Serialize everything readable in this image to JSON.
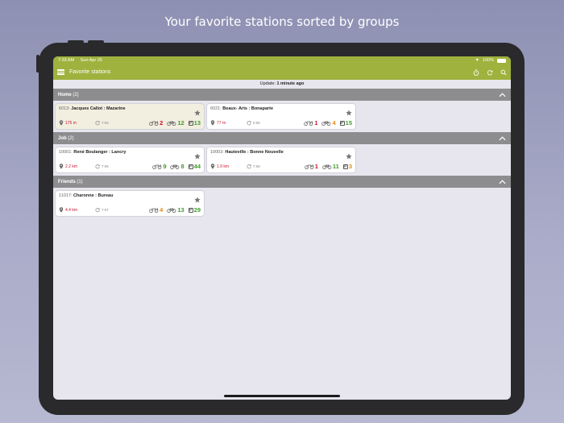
{
  "headline": "Your favorite stations sorted by groups",
  "status": {
    "time": "7:33 AM",
    "date": "Sun Apr 25",
    "battery": "100%"
  },
  "appbar": {
    "title": "Favorite stations"
  },
  "update": {
    "label": "Update:",
    "value": "1 minute ago"
  },
  "colors": {
    "accent": "#9eb23d",
    "group_header": "#8d8d8f",
    "distance": "#c8102e",
    "good": "#3f9b2a",
    "warn": "#e08a12"
  },
  "groups": [
    {
      "name": "Home",
      "count": "(2)",
      "stations": [
        {
          "id": "6013:",
          "name": "Jacques Callot : Mazarine",
          "distance": "175 m",
          "time": "7:05",
          "broken": "2",
          "bikes": "12",
          "docks": "13",
          "broken_color": "red",
          "bikes_color": "green",
          "docks_color": "green"
        },
        {
          "id": "6021:",
          "name": "Beaux- Arts : Bonaparte",
          "distance": "77 m",
          "time": "6:55",
          "broken": "1",
          "bikes": "4",
          "docks": "15",
          "broken_color": "red",
          "bikes_color": "orange",
          "docks_color": "green"
        }
      ]
    },
    {
      "name": "Job",
      "count": "(2)",
      "stations": [
        {
          "id": "10001:",
          "name": "René Boulanger : Lancry",
          "distance": "2.2 km",
          "time": "7:06",
          "broken": "9",
          "bikes": "8",
          "docks": "44",
          "broken_color": "green",
          "bikes_color": "green",
          "docks_color": "green"
        },
        {
          "id": "10003:",
          "name": "Hauteville : Bonne Nouvelle",
          "distance": "1.9 km",
          "time": "7:06",
          "broken": "1",
          "bikes": "11",
          "docks": "3",
          "broken_color": "red",
          "bikes_color": "green",
          "docks_color": "orange"
        }
      ]
    },
    {
      "name": "Friends",
      "count": "(1)",
      "stations": [
        {
          "id": "11017:",
          "name": "Charonne : Bureau",
          "distance": "4.4 km",
          "time": "7:07",
          "broken": "4",
          "bikes": "13",
          "docks": "29",
          "broken_color": "orange",
          "bikes_color": "green",
          "docks_color": "green"
        }
      ]
    }
  ]
}
